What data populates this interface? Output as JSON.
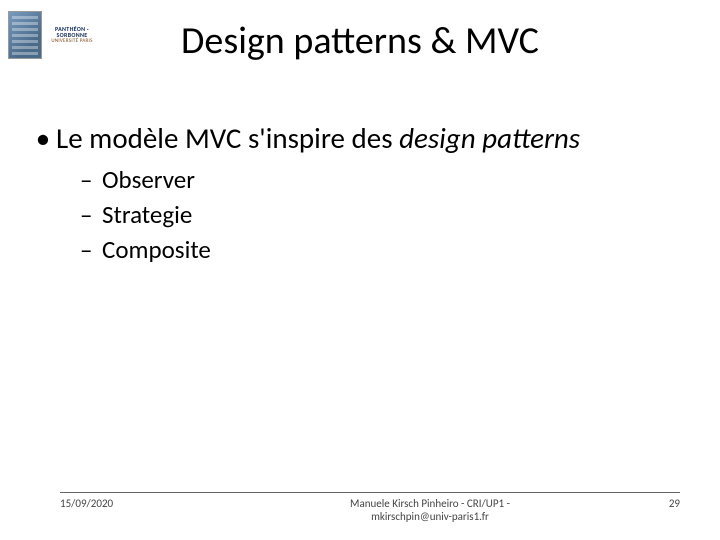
{
  "logo": {
    "line1": "PANTHÉON · SORBONNE",
    "line2": "UNIVERSITÉ PARIS"
  },
  "title": "Design patterns & MVC",
  "content": {
    "main_point": {
      "prefix": "Le modèle MVC s'inspire des ",
      "emph": "design patterns"
    },
    "sub_points": [
      "Observer",
      "Strategie",
      "Composite"
    ]
  },
  "footer": {
    "date": "15/09/2020",
    "author_line1": "Manuele Kirsch Pinheiro - CRI/UP1 -",
    "author_line2": "mkirschpin@univ-paris1.fr",
    "page": "29"
  }
}
